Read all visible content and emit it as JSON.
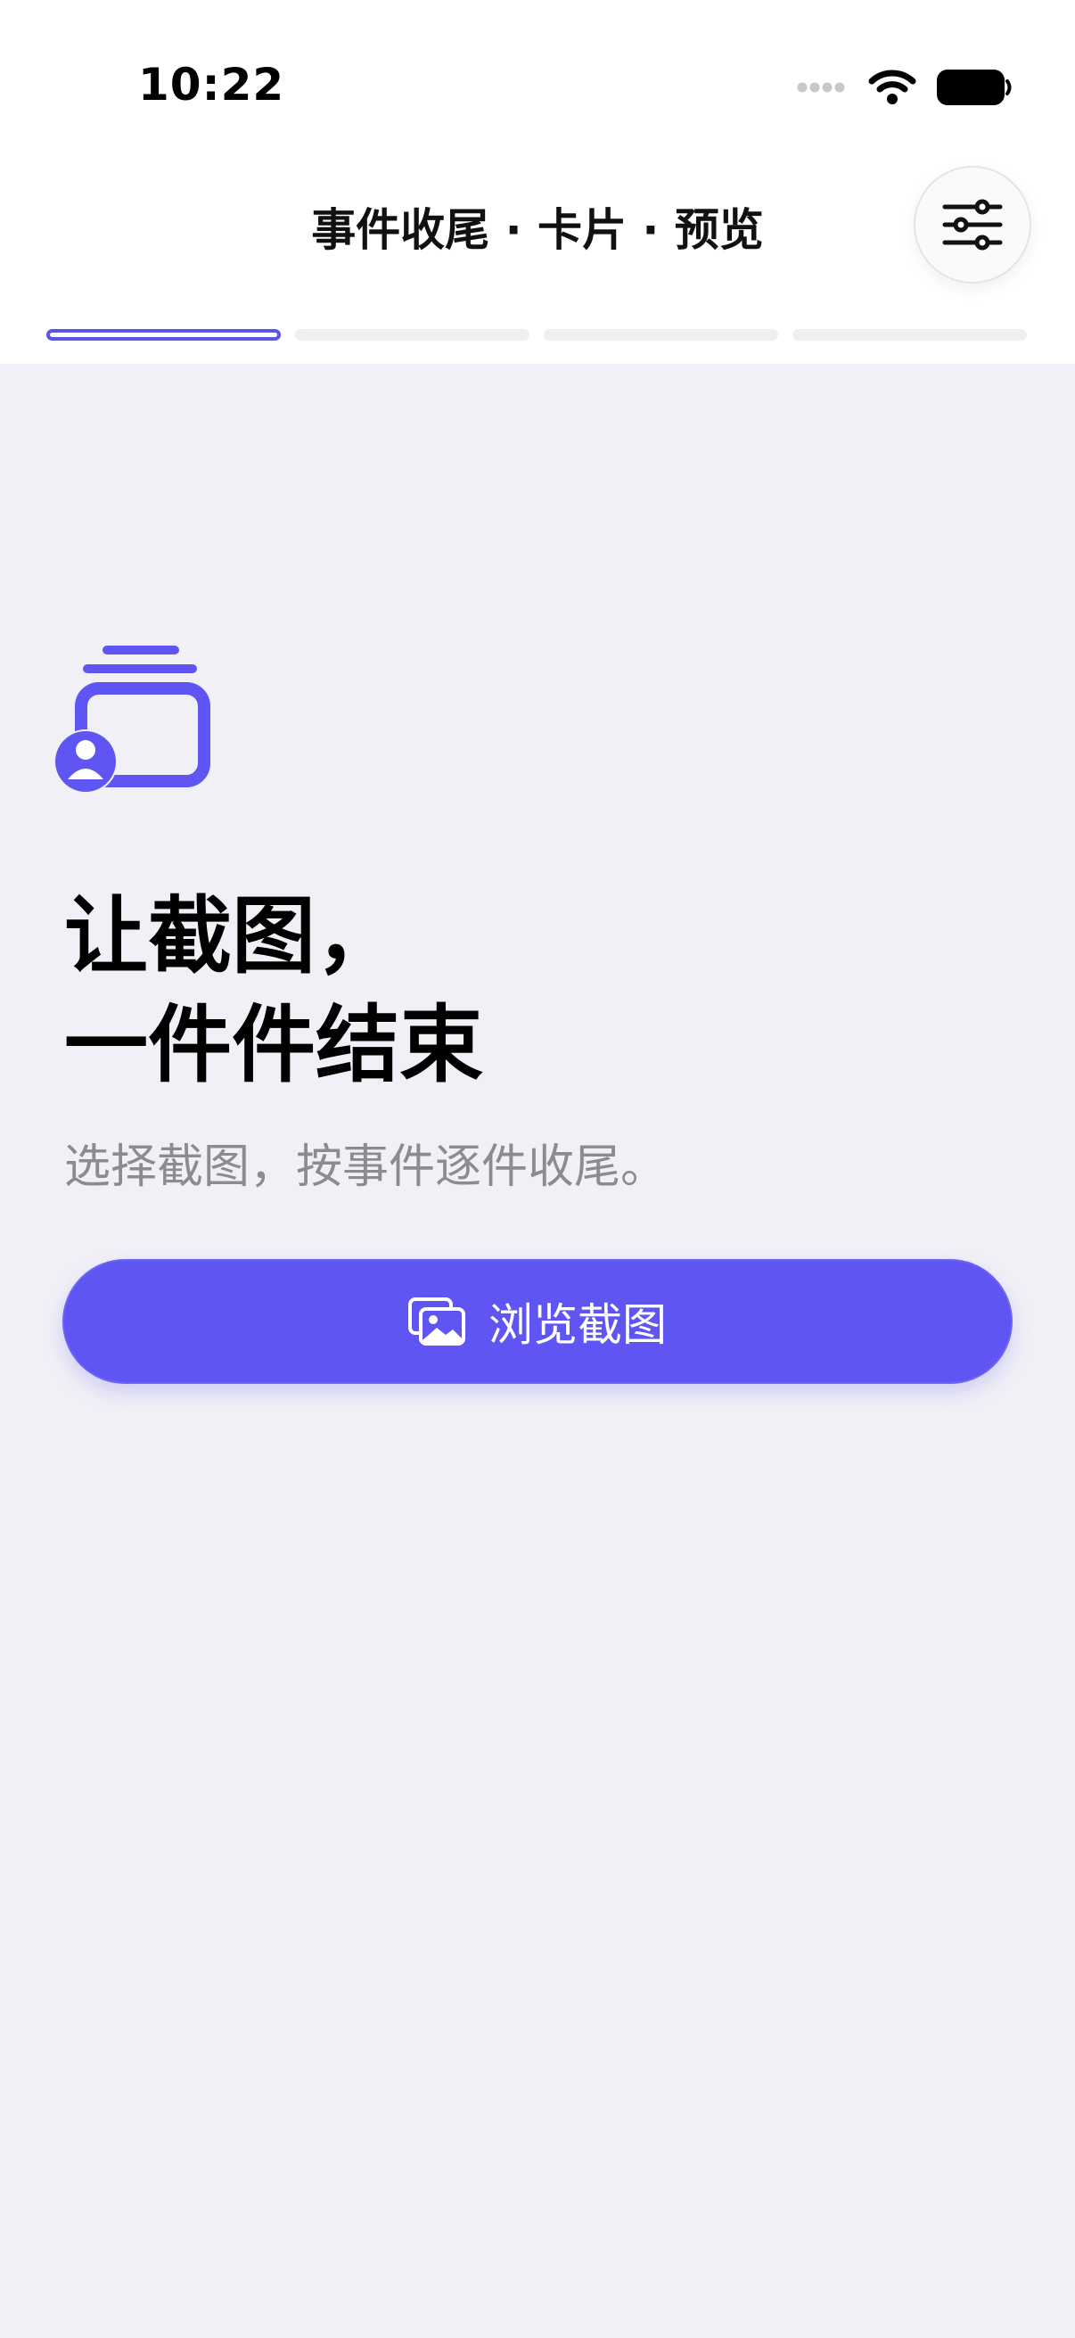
{
  "status_bar": {
    "time": "10:22"
  },
  "nav": {
    "title": "事件收尾 · 卡片 · 预览",
    "settings_icon": "sliders-icon"
  },
  "progress": {
    "total_steps": 4,
    "current_step": 1,
    "accent": "#5b54e8"
  },
  "hero": {
    "icon": "screenshots-stack-user-icon",
    "headline_line1": "让截图，",
    "headline_line2": "一件件结束",
    "subtitle": "选择截图，按事件逐件收尾。"
  },
  "primary_button": {
    "label": "浏览截图",
    "icon": "photos-icon",
    "color": "#5e55f3"
  }
}
